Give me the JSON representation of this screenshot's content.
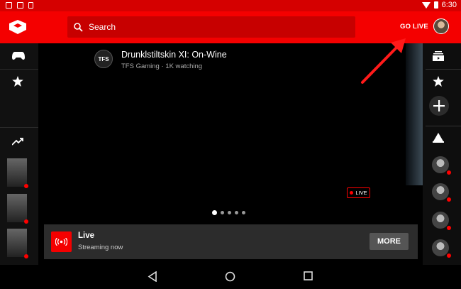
{
  "status_bar": {
    "time": "6:30"
  },
  "app_bar": {
    "search_placeholder": "Search",
    "go_live_label": "GO LIVE"
  },
  "featured": {
    "channel_logo_text": "TFS",
    "title": "Drunklstiltskin XI: On-Wine",
    "channel": "TFS Gaming",
    "viewers": "1K watching",
    "subtitle": "TFS Gaming · 1K watching",
    "live_badge": "LIVE",
    "carousel_pages": 5,
    "carousel_active": 1
  },
  "live_card": {
    "title": "Live",
    "subtitle": "Streaming now",
    "button_label": "MORE"
  },
  "colors": {
    "brand_red": "#f40000",
    "status_red": "#d50000",
    "search_bg": "#c70000"
  },
  "icons": {
    "left_rail": [
      "gamepad-icon",
      "star-icon",
      "trending-icon"
    ],
    "right_rail": [
      "subscriptions-icon",
      "star-icon",
      "add-icon",
      "gaming-icon"
    ]
  }
}
